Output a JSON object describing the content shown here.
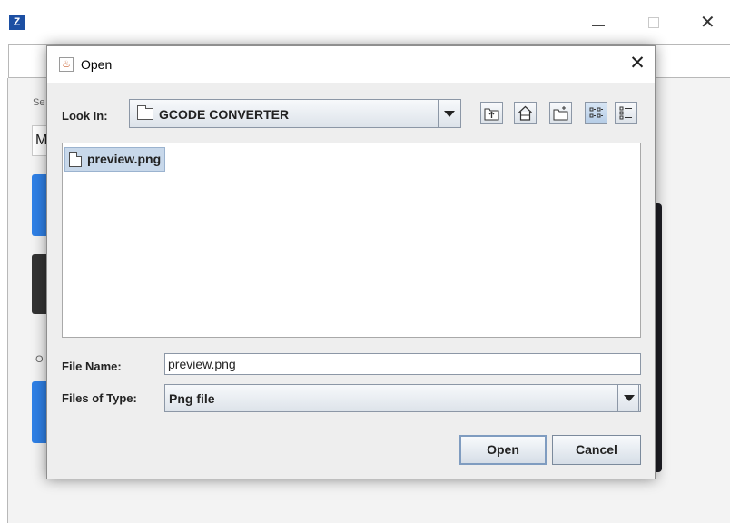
{
  "app": {
    "logo_text": "Z",
    "sidebar": {
      "label_top": "Se",
      "select_text": "M",
      "label_bottom": "O"
    },
    "window_controls": {
      "close_glyph": "✕"
    }
  },
  "dialog": {
    "title": "Open",
    "close_glyph": "✕",
    "look_in": {
      "label": "Look In:",
      "value": "GCODE CONVERTER"
    },
    "toolbar": {
      "icons": [
        "up-one-level-icon",
        "home-icon",
        "new-folder-icon",
        "list-view-icon",
        "details-view-icon"
      ]
    },
    "files": [
      {
        "name": "preview.png",
        "selected": true
      }
    ],
    "file_name": {
      "label": "File Name:",
      "value": "preview.png"
    },
    "files_of_type": {
      "label": "Files of Type:",
      "value": "Png file"
    },
    "buttons": {
      "open": "Open",
      "cancel": "Cancel"
    }
  },
  "colors": {
    "selection": "#c8d8ea",
    "accent_blue": "#2f80e6",
    "dialog_bg": "#eeeeee"
  }
}
